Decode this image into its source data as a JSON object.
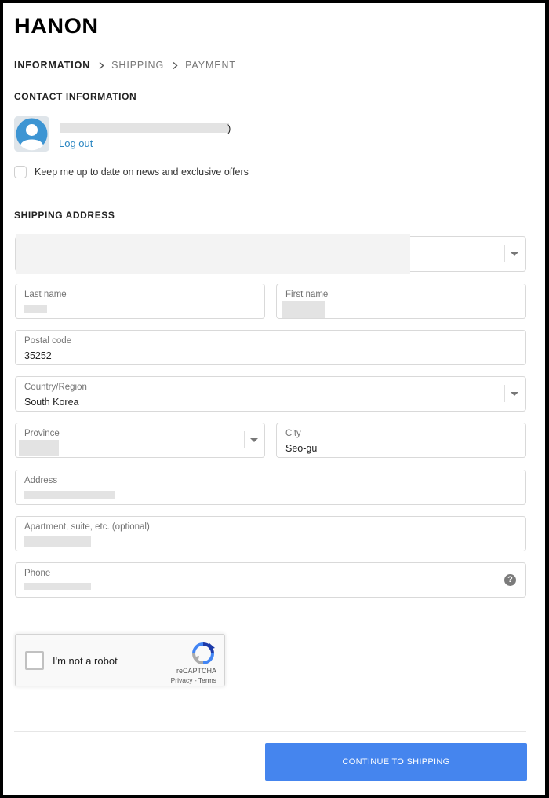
{
  "brand": {
    "logo": "HANON"
  },
  "breadcrumb": {
    "steps": [
      "INFORMATION",
      "SHIPPING",
      "PAYMENT"
    ]
  },
  "contact": {
    "title": "CONTACT INFORMATION",
    "email_suffix": ")",
    "logout_label": "Log out",
    "newsletter_label": "Keep me up to date on news and exclusive offers"
  },
  "shipping": {
    "title": "SHIPPING ADDRESS",
    "last_name_label": "Last name",
    "first_name_label": "First name",
    "postal_label": "Postal code",
    "postal_value": "35252",
    "country_label": "Country/Region",
    "country_value": "South Korea",
    "province_label": "Province",
    "city_label": "City",
    "city_value": "Seo-gu",
    "address_label": "Address",
    "apartment_label": "Apartment, suite, etc. (optional)",
    "phone_label": "Phone",
    "help_symbol": "?"
  },
  "captcha": {
    "label": "I'm not a robot",
    "brand": "reCAPTCHA",
    "links": "Privacy - Terms"
  },
  "actions": {
    "continue_label": "CONTINUE TO SHIPPING"
  },
  "colors": {
    "accent_button": "#4585ee",
    "link": "#2a86c2"
  }
}
